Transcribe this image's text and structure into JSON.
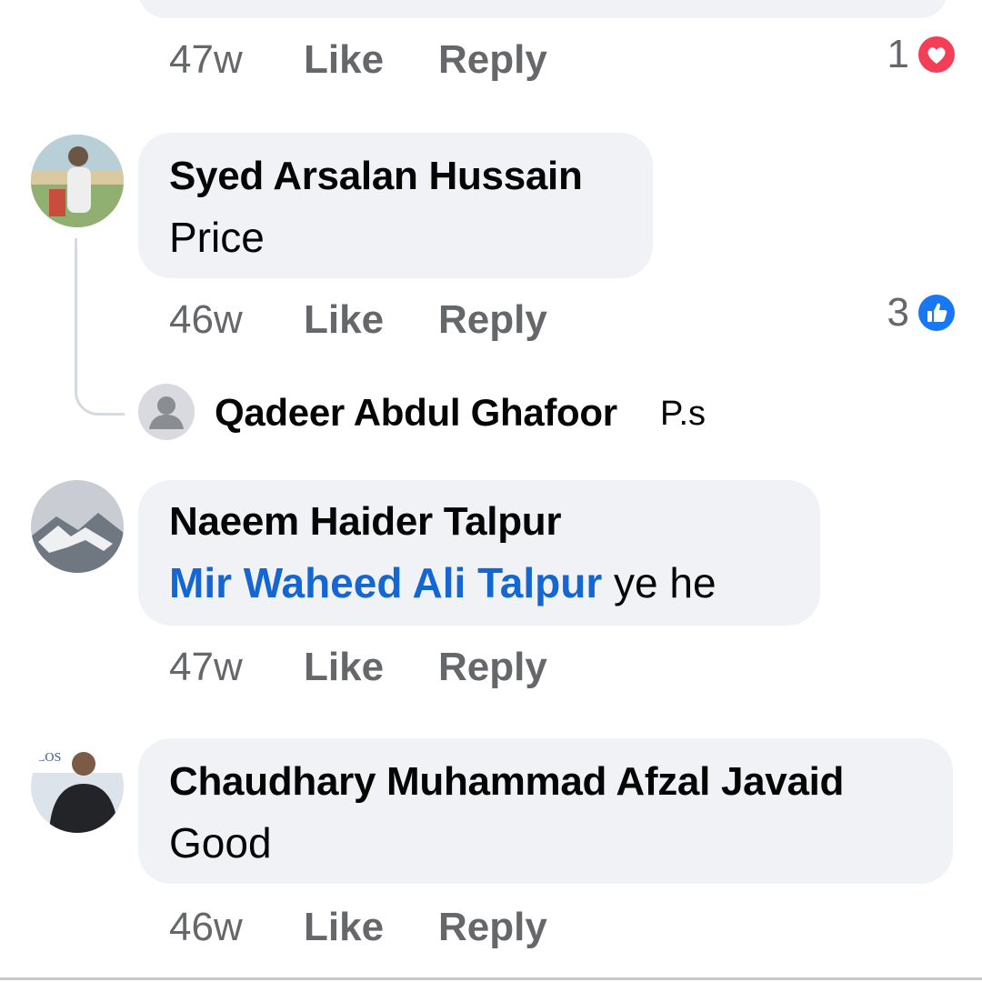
{
  "comments": [
    {
      "time": "47w",
      "like": "Like",
      "reply": "Reply",
      "reaction_count": "1",
      "reaction": "love-icon"
    },
    {
      "author": "Syed Arsalan Hussain",
      "text": "Price",
      "time": "46w",
      "like": "Like",
      "reply": "Reply",
      "reaction_count": "3",
      "reaction": "like-icon",
      "reply_preview": {
        "author": "Qadeer Abdul Ghafoor",
        "text": "P.s"
      }
    },
    {
      "author": "Naeem Haider Talpur",
      "mention": "Mir Waheed Ali Talpur",
      "text": "ye he",
      "time": "47w",
      "like": "Like",
      "reply": "Reply"
    },
    {
      "author": "Chaudhary Muhammad Afzal Javaid",
      "text": "Good",
      "avatar_text": "COS",
      "time": "46w",
      "like": "Like",
      "reply": "Reply"
    }
  ],
  "colors": {
    "bubble": "#f0f2f5",
    "meta": "#65676b",
    "mention": "#1467d2",
    "love": "#f33e58",
    "like": "#1877f2"
  }
}
